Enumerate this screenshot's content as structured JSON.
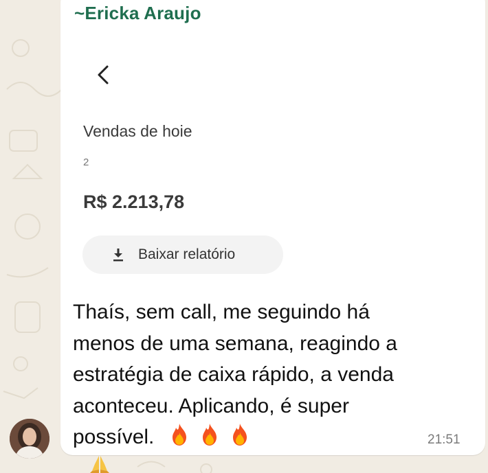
{
  "chat": {
    "sender_name": "~Ericka Araujo",
    "timestamp": "21:51",
    "sender_color": "#1f6e4f",
    "avatar_icon": "contact-photo",
    "reaction_icon": "praying-hands-emoji"
  },
  "shared_screenshot": {
    "back_icon": "chevron-left-icon",
    "title": "Vendas de hoie",
    "subtitle": "2",
    "amount": "R$ 2.213,78",
    "download_button": {
      "icon": "download-icon",
      "label": "Baixar relatório"
    }
  },
  "message": {
    "lines": [
      "Thaís, sem call, me seguindo há",
      "menos de uma semana, reagindo a",
      "estratégia de caixa rápido, a venda",
      "aconteceu. Aplicando, é super",
      "possível."
    ],
    "emoji": "fire-emoji",
    "emoji_count": 3
  }
}
